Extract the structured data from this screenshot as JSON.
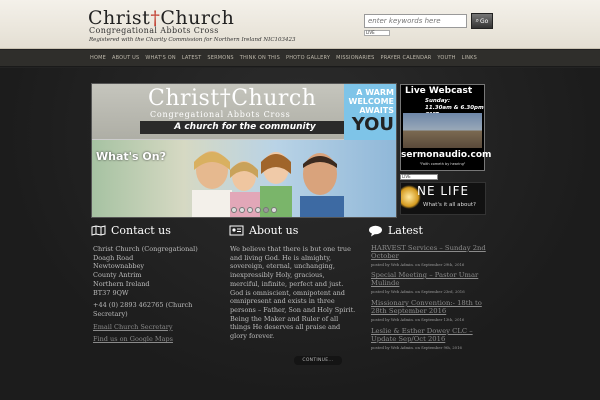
{
  "header": {
    "logo_title_a": "Christ",
    "logo_title_b": "Church",
    "logo_subtitle": "Congregational Abbots Cross",
    "logo_registration": "Registered with the Charity Commission for Northern Ireland NIC103423",
    "search_placeholder": "enter keywords here",
    "search_button": "Go",
    "search_hint": "LIVE"
  },
  "nav": {
    "items": [
      "Home",
      "About Us",
      "What's On",
      "Latest",
      "Sermons",
      "Think on This",
      "Photo Gallery",
      "Missionaries",
      "Prayer Calendar",
      "Youth",
      "Links"
    ]
  },
  "hero": {
    "title_a": "Christ",
    "title_b": "Church",
    "subtitle": "Congregational Abbots Cross",
    "tagline": "A church for the community",
    "badge_line1": "A WARM",
    "badge_line2": "WELCOME",
    "badge_line3": "AWAITS",
    "badge_line4": "YOU",
    "whats_on": "What's On?",
    "slide_count": 6,
    "active_slide": 5
  },
  "webcast": {
    "title": "Live Webcast",
    "day": "Sunday:",
    "times": "11.30am & 6.30pm GMT",
    "brand": "sermonaudio.com",
    "brand_sub": "\"Faith cometh by hearing\"",
    "live_label": "LIVE"
  },
  "onelife": {
    "title": "NE LIFE",
    "subtitle": "What's it all about?"
  },
  "contact": {
    "heading": "Contact us",
    "lines": [
      "Christ Church (Congregational)",
      "Doagh Road",
      "Newtownabbey",
      "County Antrim",
      "Northern Ireland",
      "BT37 9QW"
    ],
    "phone": "+44 (0) 2893 462765 (Church Secretary)",
    "email_link": "Email Church Secretary",
    "map_link": "Find us on Google Maps"
  },
  "about": {
    "heading": "About us",
    "text": "We believe that there is but one true and living God. He is almighty, sovereign, eternal, unchanging, inexpressibly Holy, gracious, merciful, infinite, perfect and just. God is omniscient, omnipotent and omnipresent and exists in three persons – Father, Son and Holy Spirit. Being the Maker and Ruler of all things He deserves all praise and glory forever.",
    "continue": "CONTINUE..."
  },
  "latest": {
    "heading": "Latest",
    "items": [
      {
        "title": "HARVEST Services – Sunday 2nd October",
        "meta": "posted by Web Admin. on September 29th, 2016"
      },
      {
        "title": "Special Meeting – Pastor Umar Mulinde",
        "meta": "posted by Web Admin. on September 23rd, 2016"
      },
      {
        "title": "Missionary Convention:- 18th to 28th September 2016",
        "meta": "posted by Web Admin. on September 13th, 2016"
      },
      {
        "title": "Leslie & Esther Dowey CLC – Update Sep/Oct 2016",
        "meta": "posted by Web Admin. on September 9th, 2016"
      }
    ]
  }
}
